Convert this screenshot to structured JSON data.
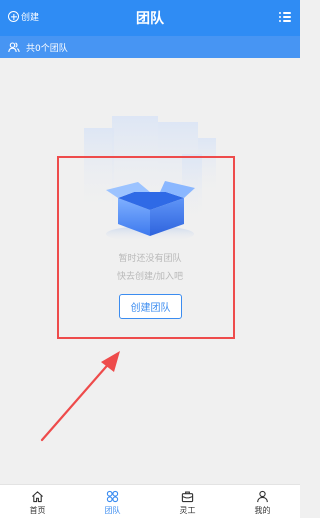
{
  "header": {
    "create_label": "创建",
    "title": "团队"
  },
  "subheader": {
    "count_text": "共0个团队"
  },
  "empty_state": {
    "line1": "暂时还没有团队",
    "line2": "快去创建/加入吧",
    "button_label": "创建团队"
  },
  "bottom_nav": [
    {
      "label": "首页",
      "icon": "home-icon",
      "active": false
    },
    {
      "label": "团队",
      "icon": "team-grid-icon",
      "active": true
    },
    {
      "label": "灵工",
      "icon": "briefcase-icon",
      "active": false
    },
    {
      "label": "我的",
      "icon": "person-icon",
      "active": false
    }
  ],
  "colors": {
    "primary": "#2f8cf4",
    "subbar": "#4795f3",
    "annotation": "#ee4b4b"
  }
}
